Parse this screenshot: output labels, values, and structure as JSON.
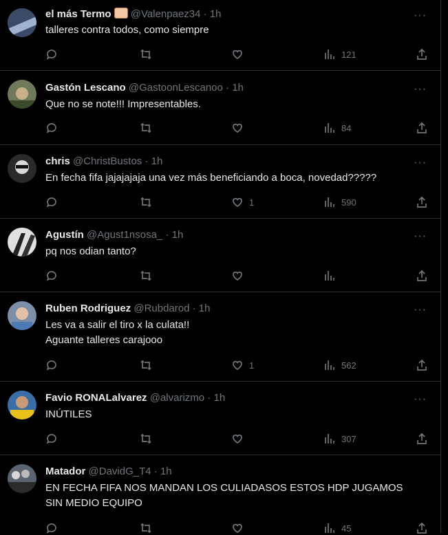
{
  "tweets": [
    {
      "name": "el más Termo",
      "badge_icon": "fist-emoji-icon",
      "handle": "@Valenpaez34",
      "sep": "·",
      "time": "1h",
      "text": [
        "talleres contra todos, como siempre"
      ],
      "likes": "",
      "views": "121",
      "avatar_color": "#3b4a66"
    },
    {
      "name": "Gastón Lescano",
      "handle": "@GastoonLescanoo",
      "sep": "·",
      "time": "1h",
      "text": [
        "Que no se note!!! Impresentables."
      ],
      "likes": "",
      "views": "84",
      "avatar_color": "#6f7a58"
    },
    {
      "name": "chris",
      "handle": "@ChristBustos",
      "sep": "·",
      "time": "1h",
      "text": [
        "En fecha fifa jajajajaja una vez más beneficiando a boca, novedad?????"
      ],
      "likes": "1",
      "views": "590",
      "avatar_color": "#555555"
    },
    {
      "name": "Agustín",
      "handle": "@Agust1nsosa_",
      "sep": "·",
      "time": "1h",
      "text": [
        "pq nos odian tanto?"
      ],
      "likes": "",
      "views": "",
      "avatar_color": "#8a8a8a"
    },
    {
      "name": "Ruben Rodriguez",
      "handle": "@Rubdarod",
      "sep": "·",
      "time": "1h",
      "text": [
        "Les va a salir el tiro x la culata!!",
        "Aguante talleres carajooo"
      ],
      "likes": "1",
      "views": "562",
      "avatar_color": "#7d8fa8"
    },
    {
      "name": "Favio RONALalvarez",
      "handle": "@alvarizmo",
      "sep": "·",
      "time": "1h",
      "text": [
        "INÚTILES"
      ],
      "likes": "",
      "views": "307",
      "avatar_color": "#d6b31a"
    },
    {
      "name": "Matador",
      "handle": "@DavidG_T4",
      "sep": "·",
      "time": "1h",
      "text": [
        "EN FECHA FIFA NOS MANDAN LOS CULIADASOS ESTOS HDP JUGAMOS",
        "SIN MEDIO EQUIPO"
      ],
      "likes": "",
      "views": "45",
      "avatar_color": "#5a6470"
    }
  ],
  "more_label": "···"
}
